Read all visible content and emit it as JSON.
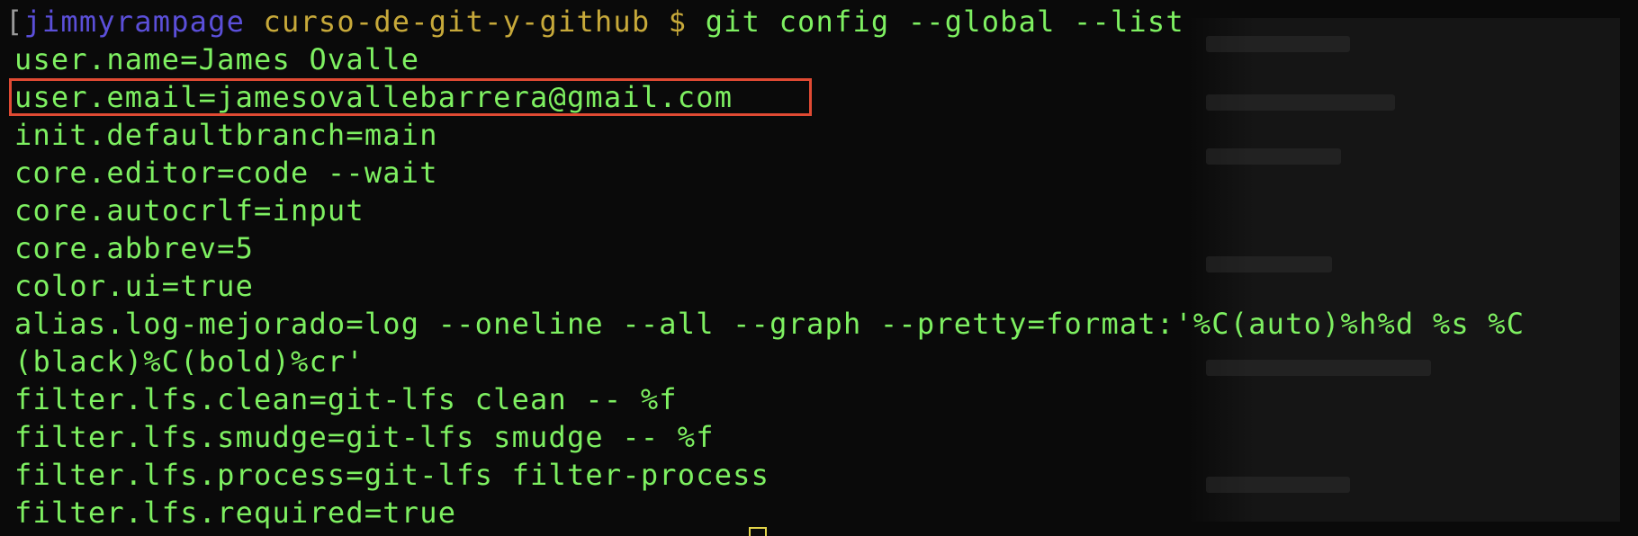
{
  "prompt": {
    "bracket": "[",
    "user": "jimmyrampage",
    "directory": "curso-de-git-y-github",
    "symbol": "$",
    "command": "git config --global --list"
  },
  "output_lines": [
    "user.name=James Ovalle",
    "user.email=jamesovallebarrera@gmail.com",
    "init.defaultbranch=main",
    "core.editor=code --wait",
    "core.autocrlf=input",
    "core.abbrev=5",
    "color.ui=true",
    "alias.log-mejorado=log --oneline --all --graph --pretty=format:'%C(auto)%h%d %s %C",
    "(black)%C(bold)%cr'",
    "filter.lfs.clean=git-lfs clean -- %f",
    "filter.lfs.smudge=git-lfs smudge -- %f",
    "filter.lfs.process=git-lfs filter-process",
    "filter.lfs.required=true"
  ],
  "highlighted_line": "user.email=jamesovallebarrera@gmail.com",
  "colors": {
    "background": "#0a0a0a",
    "text": "#7ef061",
    "user": "#5b4fd9",
    "path": "#c7a93a",
    "highlight_box": "#e04a33",
    "cursor": "#e3d54a"
  }
}
